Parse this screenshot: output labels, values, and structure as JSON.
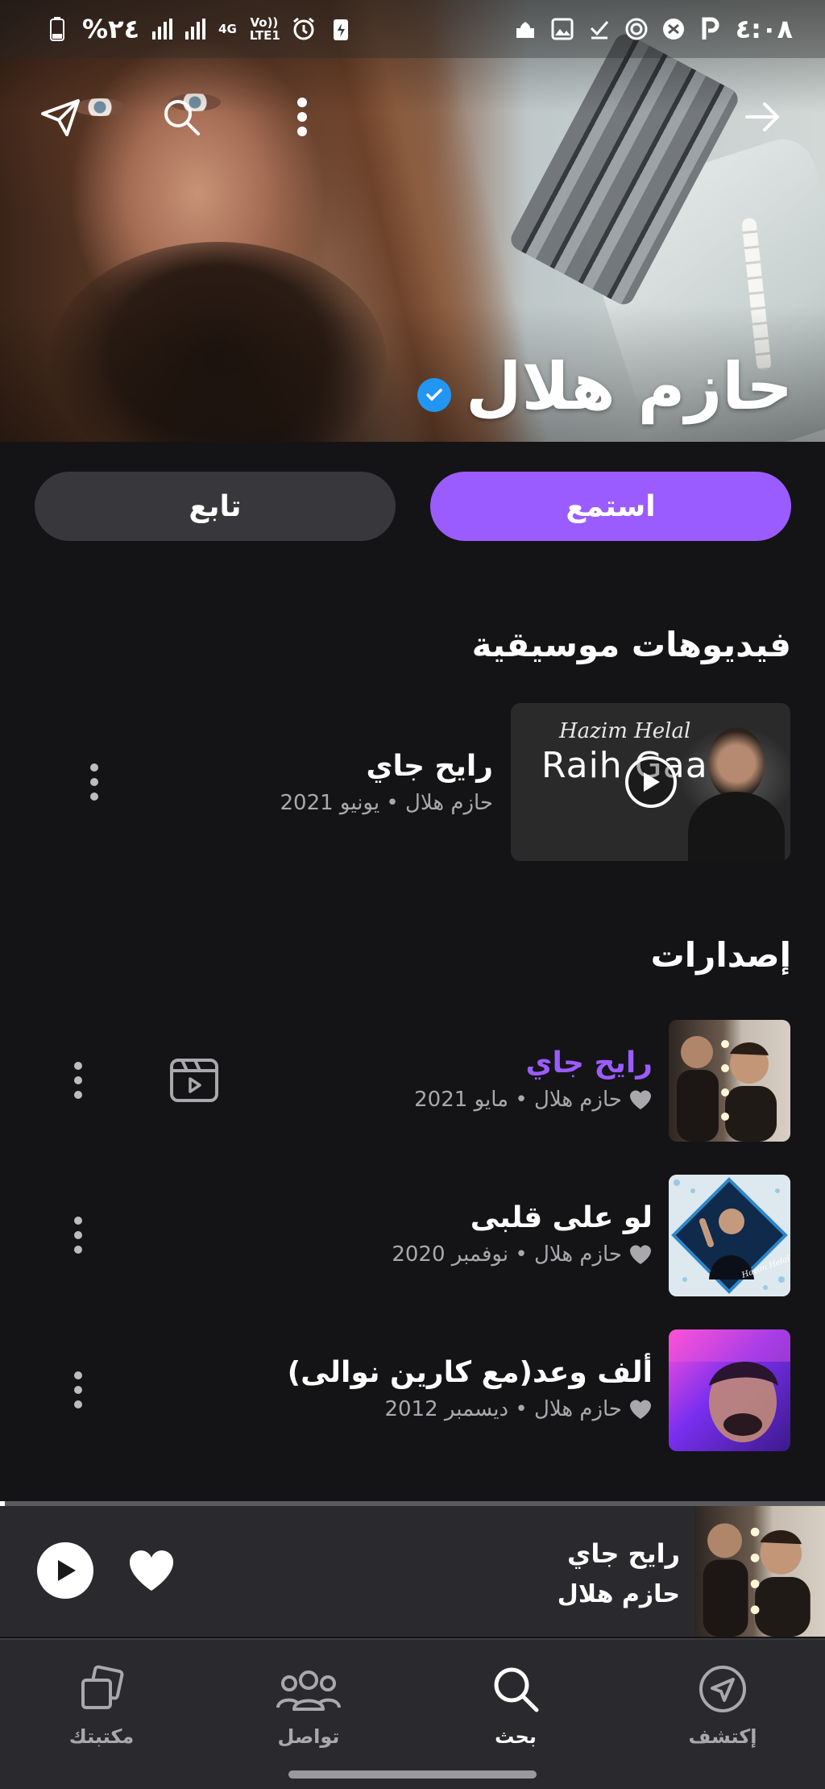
{
  "status_bar": {
    "time": "٤:٠٨",
    "battery": "%٢٤",
    "network": "4G",
    "volte": "Vo)) LTE1"
  },
  "artist": {
    "name": "حازم هلال",
    "verified": true
  },
  "actions": {
    "listen_label": "استمع",
    "follow_label": "تابع"
  },
  "music_videos": {
    "title": "فيديوهات موسيقية",
    "items": [
      {
        "title": "رايح جاي",
        "subtitle": "حازم هلال • يونيو 2021",
        "thumb_script": "Hazim Helal",
        "thumb_title": "Raih Gaai"
      }
    ]
  },
  "releases": {
    "title": "إصدارات",
    "items": [
      {
        "title": "رايح جاي",
        "subtitle": "حازم هلال • مايو 2021",
        "highlighted": true,
        "has_video": true
      },
      {
        "title": "لو على قلبى",
        "subtitle": "حازم هلال • نوفمبر 2020",
        "highlighted": false,
        "has_video": false
      },
      {
        "title": "ألف وعد(مع كارين نوالى)",
        "subtitle": "حازم هلال • ديسمبر 2012",
        "highlighted": false,
        "has_video": false
      }
    ]
  },
  "now_playing": {
    "title": "رايح جاي",
    "artist": "حازم هلال",
    "progress": 0.005
  },
  "bottom_nav": {
    "items": [
      {
        "label": "إكتشف",
        "icon": "compass-icon",
        "active": false
      },
      {
        "label": "بحث",
        "icon": "search-icon",
        "active": true
      },
      {
        "label": "تواصل",
        "icon": "people-icon",
        "active": false
      },
      {
        "label": "مكتبتك",
        "icon": "library-icon",
        "active": false
      }
    ]
  },
  "colors": {
    "accent": "#9b5cff",
    "background": "#141416",
    "verified": "#2196f3"
  }
}
